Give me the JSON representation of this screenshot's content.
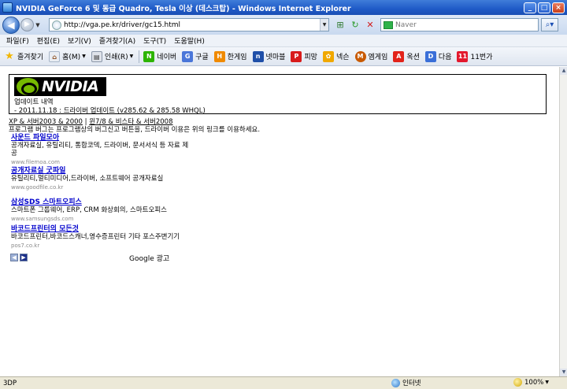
{
  "window": {
    "title": "NVIDIA GeForce 6 및 동급 Quadro, Tesla 이상 (데스크탑) - Windows Internet Explorer"
  },
  "address_bar": {
    "url": "http://vga.pe.kr/driver/gc15.html"
  },
  "search_box": {
    "placeholder": "Naver"
  },
  "menu": [
    "파일(F)",
    "편집(E)",
    "보기(V)",
    "즐겨찾기(A)",
    "도구(T)",
    "도움말(H)"
  ],
  "favorites_bar": {
    "favorites_label": "즐겨찾기",
    "home_label": "홈(M)",
    "print_label": "인쇄(R)",
    "links": [
      {
        "label": "네이버",
        "icon": "naver-icon",
        "color": "#2db400"
      },
      {
        "label": "구글",
        "icon": "google-icon",
        "color": "#4a76d9"
      },
      {
        "label": "한게임",
        "icon": "hangame-icon",
        "color": "#f08a00"
      },
      {
        "label": "넷마블",
        "icon": "netmarble-icon",
        "color": "#1f4fa8"
      },
      {
        "label": "피망",
        "icon": "pmang-icon",
        "color": "#d81b1b"
      },
      {
        "label": "넥슨",
        "icon": "nexon-icon",
        "color": "#f0a800"
      },
      {
        "label": "엠게임",
        "icon": "mgame-icon",
        "color": "#c85a00"
      },
      {
        "label": "옥션",
        "icon": "auction-icon",
        "color": "#e2231a"
      },
      {
        "label": "다음",
        "icon": "daum-icon",
        "color": "#3a6fd8"
      },
      {
        "label": "11번가",
        "icon": "11st-icon",
        "color": "#e3182d"
      }
    ]
  },
  "page": {
    "logo_text": "NVIDIA",
    "update_title": "업데이트 내역",
    "update_line": "- 2011.11.18 : 드라이버 업데이트 (v285.62 & 285.58 WHQL)",
    "os_link_1": "XP & 서버2003 & 2000",
    "os_separator": " | ",
    "os_link_2": "윈7/8 & 비스타 & 서버2008",
    "notice": "프로그램 버그는 프로그램상의 버그신고 버튼을, 드라이버 이용은 위의 링크를 이용하세요.",
    "ads": [
      {
        "title": "사운드 파일모아",
        "desc": "공개자료실, 유틸리티, 통합코덱, 드라이버, 문서서식 등 자료 제공",
        "url": "www.filemoa.com"
      },
      {
        "title": "공개자료실 굿파일",
        "desc": "유틸리티,멀티미디어,드라이버, 소프트웨어 공개자료실",
        "url": "www.goodfile.co.kr"
      },
      {
        "title": "삼성SDS 스마트오피스",
        "desc": "스마트폰 그룹웨어, ERP, CRM 화상회의, 스마트오피스",
        "url": "www.samsungsds.com"
      },
      {
        "title": "바코드프린터의 모든것",
        "desc": "바코드프린터,바코드스캐너,영수증프린터 기타 포스주변기기",
        "url": "pos7.co.kr"
      }
    ],
    "google_ads_label": "Google 광고"
  },
  "status_bar": {
    "text": "3DP",
    "zone": "인터넷",
    "zoom": "100%"
  }
}
